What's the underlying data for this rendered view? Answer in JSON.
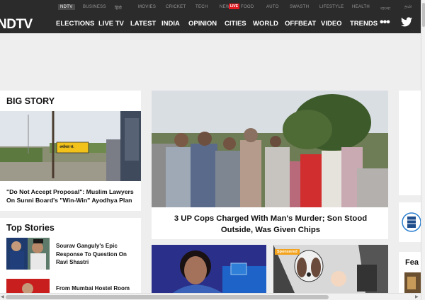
{
  "network_bar": {
    "items": [
      "NDTV",
      "BUSINESS",
      "हिंदी",
      "MOVIES",
      "CRICKET",
      "TECH",
      "NEWS",
      "FOOD",
      "AUTO",
      "SWASTH",
      "LIFESTYLE",
      "HEALTH",
      "বাংলা",
      "தமி"
    ],
    "live_badge": "LIVE"
  },
  "main_nav": {
    "logo": "NDTV",
    "links": [
      "ELECTIONS",
      "LIVE TV",
      "LATEST",
      "INDIA",
      "OPINION",
      "CITIES",
      "WORLD",
      "OFFBEAT",
      "VIDEO",
      "TRENDS"
    ],
    "more": "•••"
  },
  "big_story": {
    "section_title": "BIG STORY",
    "headline": "\"Do Not Accept Proposal\": Muslim Lawyers On Sunni Board's \"Win-Win\" Ayodhya Plan",
    "sign_text": "अयोध्या जं."
  },
  "lead_story": {
    "headline": "3 UP Cops Charged With Man's Murder; Son Stood Outside, Was Given Chips"
  },
  "top_stories": {
    "section_title": "Top Stories",
    "items": [
      {
        "title": "Sourav Ganguly's Epic Response To Question On Ravi Shastri"
      },
      {
        "title": "From Mumbai Hostel Room"
      }
    ]
  },
  "bottom_cards": {
    "sponsored_label": "Sponsored"
  },
  "right_partial": {
    "label": "Fea"
  },
  "colors": {
    "nav_bg": "#2b2b2b",
    "live_red": "#e21b23",
    "page_bg": "#eeeeee",
    "sponsored_orange": "#f3a21b"
  }
}
